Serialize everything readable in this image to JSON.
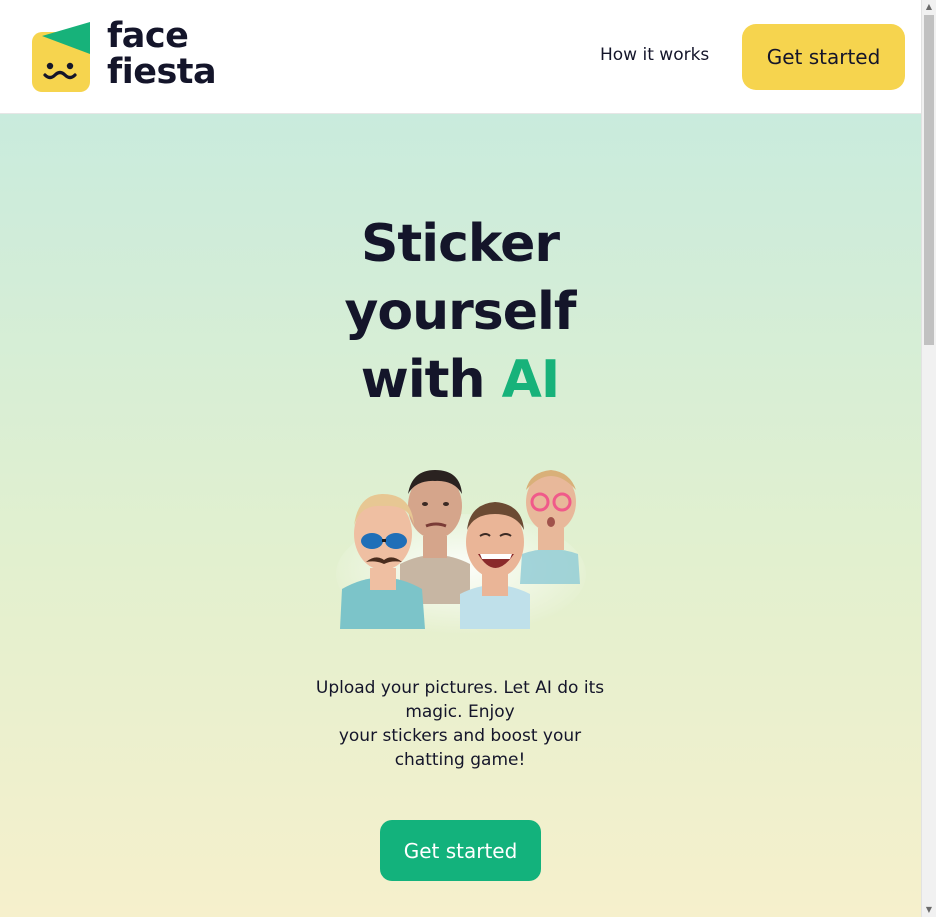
{
  "brand": {
    "name_line1": "face",
    "name_line2": "fiesta",
    "colors": {
      "yellow": "#f6d44e",
      "green": "#17b27a",
      "dark": "#14152a"
    },
    "logo_icon": "smiling-face-with-party-hat-icon"
  },
  "nav": {
    "how_it_works": "How it works",
    "cta_label": "Get started"
  },
  "hero": {
    "title_line1": "Sticker",
    "title_line2": "yourself",
    "title_line3_prefix": "with ",
    "title_line3_accent": "AI",
    "description_line1": "Upload your pictures. Let AI do its",
    "description_line2": "magic. Enjoy",
    "description_line3": "your stickers and boost your",
    "description_line4": "chatting game!",
    "cta_label": "Get started",
    "image_icon": "ai-face-stickers-collage"
  },
  "scrollbar": {
    "up_icon": "scroll-up-arrow-icon",
    "down_icon": "scroll-down-arrow-icon"
  }
}
